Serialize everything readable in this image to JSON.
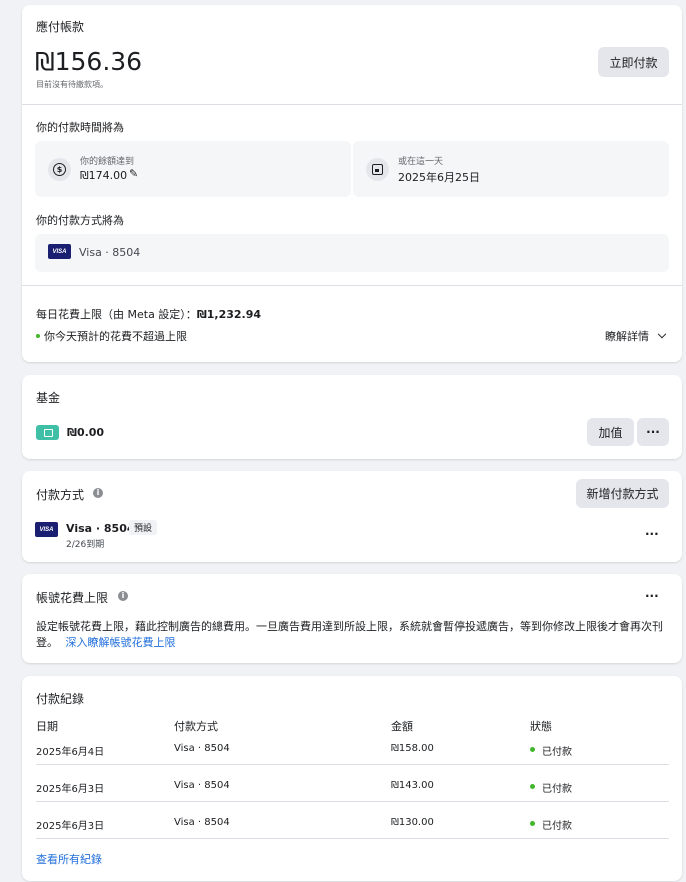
{
  "balance": {
    "title": "應付帳款",
    "amount": "₪156.36",
    "subtitle": "目前沒有待繳款項。",
    "pay_now_label": "立即付款",
    "schedule_heading": "你的付款時間將為",
    "threshold_label": "你的餘額達到",
    "threshold_value": "₪174.00",
    "date_label": "或在這一天",
    "date_value": "2025年6月25日",
    "method_heading": "你的付款方式將為",
    "method_value": "Visa · 8504",
    "daily_limit_label": "每日花費上限（由 Meta 設定）：",
    "daily_limit_value": "₪1,232.94",
    "daily_status": "你今天預計的花費不超過上限",
    "learn_more": "瞭解詳情"
  },
  "funds": {
    "title": "基金",
    "amount": "₪0.00",
    "add_value_label": "加值",
    "more_label": "···"
  },
  "payment_methods": {
    "title": "付款方式",
    "add_label": "新增付款方式",
    "card_name": "Visa · 8504",
    "default_badge": "預設",
    "expiry": "2/26到期",
    "more_label": "···"
  },
  "spending_limit": {
    "title": "帳號花費上限",
    "more_label": "···",
    "description": "設定帳號花費上限，藉此控制廣告的總費用。一旦廣告費用達到所設上限，系統就會暫停投遞廣告，等到你修改上限後才會再次刊登。",
    "link": "深入瞭解帳號花費上限"
  },
  "history": {
    "title": "付款紀錄",
    "columns": [
      "日期",
      "付款方式",
      "金額",
      "狀態"
    ],
    "rows": [
      {
        "date": "2025年6月4日",
        "method": "Visa · 8504",
        "amount": "₪158.00",
        "status": "已付款"
      },
      {
        "date": "2025年6月3日",
        "method": "Visa · 8504",
        "amount": "₪143.00",
        "status": "已付款"
      },
      {
        "date": "2025年6月3日",
        "method": "Visa · 8504",
        "amount": "₪130.00",
        "status": "已付款"
      }
    ],
    "view_all": "查看所有紀錄"
  },
  "colors": {
    "status_green": "#42b72a",
    "link_blue": "#216fdb",
    "visa_navy": "#1a1f71",
    "wallet_teal": "#3fbfa5"
  },
  "icons": [
    "dollar-icon",
    "calendar-icon",
    "edit-pencil-icon",
    "visa-icon",
    "wallet-icon",
    "info-icon",
    "chevron-down-icon",
    "more-icon"
  ]
}
